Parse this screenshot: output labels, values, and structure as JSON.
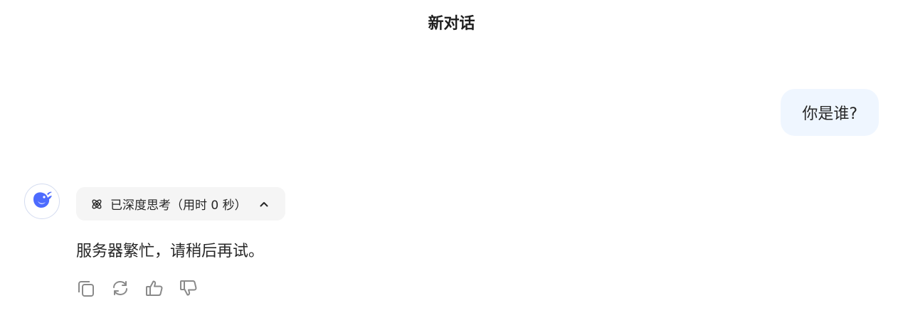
{
  "header": {
    "title": "新对话"
  },
  "messages": {
    "user": {
      "text": "你是谁?"
    },
    "assistant": {
      "thinking_label": "已深度思考（用时 0 秒）",
      "answer": "服务器繁忙，请稍后再试。"
    }
  },
  "icons": {
    "avatar": "deepseek-whale-icon",
    "thinking": "atom-icon",
    "toggle": "chevron-up-icon",
    "actions": [
      "copy-icon",
      "regenerate-icon",
      "thumbs-up-icon",
      "thumbs-down-icon"
    ]
  },
  "colors": {
    "user_bubble": "#eff6ff",
    "think_pill": "#f5f5f5",
    "brand": "#4d6bfe",
    "icon_gray": "#8a8a8a"
  }
}
